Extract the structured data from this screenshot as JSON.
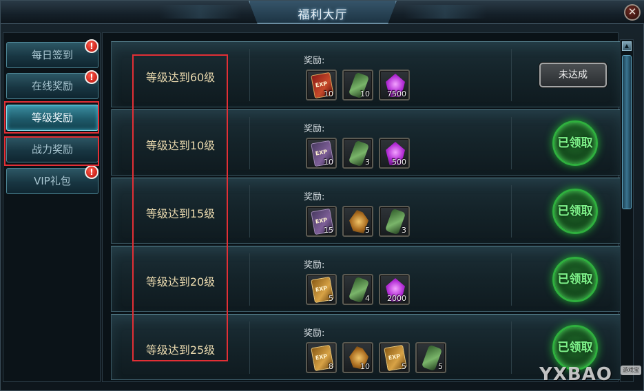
{
  "window": {
    "title": "福利大厅",
    "close_label": "✕"
  },
  "sidebar": {
    "tabs": [
      {
        "label": "每日签到",
        "alert": "!"
      },
      {
        "label": "在线奖励",
        "alert": "!"
      },
      {
        "label": "等级奖励",
        "alert": ""
      },
      {
        "label": "战力奖励",
        "alert": ""
      },
      {
        "label": "VIP礼包",
        "alert": "!"
      }
    ]
  },
  "content": {
    "reward_label": "奖励:",
    "rows": [
      {
        "level": "等级达到60级",
        "items": [
          {
            "icon": "exp-scroll-red",
            "qty": "10"
          },
          {
            "icon": "green-gem",
            "qty": "10"
          },
          {
            "icon": "purple-crystal",
            "qty": "7500"
          }
        ],
        "status": "未达成"
      },
      {
        "level": "等级达到10级",
        "items": [
          {
            "icon": "exp-scroll-purple",
            "qty": "10"
          },
          {
            "icon": "green-gem",
            "qty": "3"
          },
          {
            "icon": "purple-crystal",
            "qty": "500"
          }
        ],
        "status": "已领取"
      },
      {
        "level": "等级达到15级",
        "items": [
          {
            "icon": "exp-scroll-purple",
            "qty": "15"
          },
          {
            "icon": "golden-hand",
            "qty": "5"
          },
          {
            "icon": "green-gem",
            "qty": "3"
          }
        ],
        "status": "已领取"
      },
      {
        "level": "等级达到20级",
        "items": [
          {
            "icon": "exp-scroll-gold",
            "qty": "5"
          },
          {
            "icon": "green-gem",
            "qty": "4"
          },
          {
            "icon": "purple-crystal",
            "qty": "2000"
          }
        ],
        "status": "已领取"
      },
      {
        "level": "等级达到25级",
        "items": [
          {
            "icon": "exp-scroll-gold",
            "qty": "8"
          },
          {
            "icon": "golden-hand",
            "qty": "10"
          },
          {
            "icon": "exp-scroll-gold",
            "qty": "5"
          },
          {
            "icon": "green-gem",
            "qty": "5"
          }
        ],
        "status": "已领取"
      }
    ]
  },
  "watermark": {
    "text": "YXBAO",
    "badge": "游戏宝"
  },
  "colors": {
    "highlight_box": "#e32f35",
    "claimed_green": "#2fb03e"
  }
}
